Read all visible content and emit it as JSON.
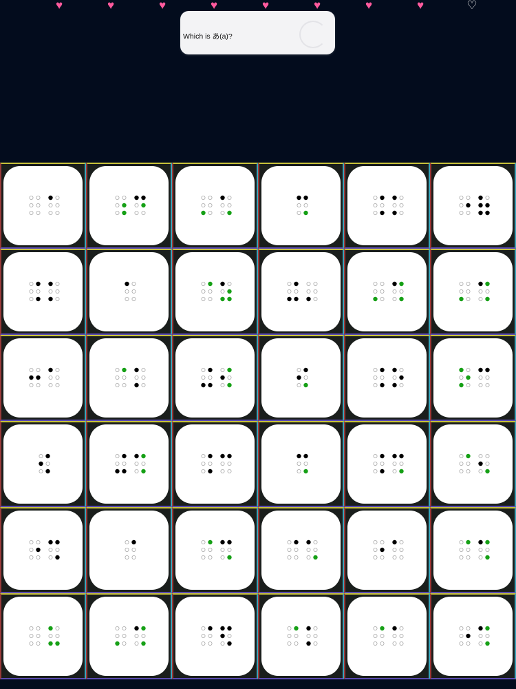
{
  "lives": {
    "total": 10,
    "remaining": 8
  },
  "question": {
    "prompt": "Which is あ(a)?"
  },
  "icons": {
    "heart_full": "heart-full-icon",
    "heart_empty": "heart-outline-icon",
    "spinner": "loading-spinner-icon"
  },
  "colors": {
    "background": "#030c1d",
    "heart": "#ff5a9d",
    "dot_raised": "#000000",
    "dot_highlight": "#16a016",
    "tile": "#ffffff"
  },
  "grid": {
    "rows": 6,
    "cols": 6,
    "cells": [
      [
        [
          0,
          0,
          0,
          0,
          0,
          0,
          1,
          0,
          0,
          0,
          0,
          0
        ]
      ],
      [
        [
          0,
          0,
          0,
          0,
          2,
          2,
          1,
          0,
          0,
          1,
          2,
          0
        ]
      ],
      [
        [
          0,
          0,
          2,
          0,
          0,
          0,
          1,
          0,
          0,
          0,
          0,
          2
        ]
      ],
      [
        [
          1,
          0,
          0,
          1,
          0,
          2
        ]
      ],
      [
        [
          0,
          0,
          0,
          1,
          0,
          1,
          1,
          0,
          1,
          0,
          0,
          0
        ]
      ],
      [
        [
          0,
          0,
          0,
          0,
          1,
          0,
          1,
          1,
          1,
          0,
          1,
          1
        ]
      ],
      [
        [
          0,
          0,
          0,
          1,
          0,
          1,
          1,
          0,
          1,
          0,
          0,
          0
        ]
      ],
      [
        [
          1,
          0,
          0,
          0,
          0,
          0
        ]
      ],
      [
        [
          0,
          0,
          0,
          2,
          0,
          0,
          1,
          0,
          2,
          0,
          2,
          2
        ]
      ],
      [
        [
          0,
          0,
          1,
          1,
          0,
          1,
          0,
          0,
          1,
          0,
          0,
          0
        ]
      ],
      [
        [
          0,
          0,
          2,
          0,
          0,
          0,
          1,
          0,
          0,
          2,
          0,
          2
        ]
      ],
      [
        [
          0,
          0,
          2,
          0,
          0,
          0,
          1,
          0,
          0,
          2,
          0,
          2
        ]
      ],
      [
        [
          0,
          1,
          0,
          0,
          1,
          0,
          1,
          0,
          0,
          0,
          0,
          0
        ]
      ],
      [
        [
          0,
          0,
          0,
          2,
          0,
          0,
          1,
          0,
          1,
          0,
          0,
          0
        ]
      ],
      [
        [
          0,
          0,
          1,
          1,
          0,
          1,
          0,
          1,
          0,
          2,
          0,
          2
        ]
      ],
      [
        [
          0,
          1,
          0,
          1,
          0,
          2
        ]
      ],
      [
        [
          0,
          0,
          0,
          1,
          0,
          1,
          1,
          0,
          1,
          0,
          1,
          0
        ]
      ],
      [
        [
          2,
          0,
          2,
          0,
          2,
          0,
          1,
          0,
          0,
          1,
          0,
          0
        ]
      ],
      [
        [
          0,
          1,
          0,
          1,
          0,
          1
        ]
      ],
      [
        [
          0,
          0,
          1,
          1,
          0,
          1,
          1,
          0,
          0,
          2,
          0,
          2
        ]
      ],
      [
        [
          0,
          0,
          0,
          1,
          0,
          1,
          1,
          0,
          0,
          1,
          0,
          0
        ]
      ],
      [
        [
          1,
          0,
          0,
          1,
          0,
          2
        ]
      ],
      [
        [
          0,
          0,
          0,
          1,
          0,
          1,
          1,
          0,
          0,
          1,
          0,
          2
        ]
      ],
      [
        [
          0,
          0,
          0,
          2,
          0,
          0,
          0,
          1,
          0,
          0,
          0,
          2
        ]
      ],
      [
        [
          0,
          0,
          0,
          0,
          1,
          0,
          1,
          0,
          0,
          1,
          0,
          1
        ]
      ],
      [
        [
          0,
          0,
          0,
          1,
          0,
          0
        ]
      ],
      [
        [
          0,
          0,
          0,
          2,
          0,
          0,
          1,
          0,
          0,
          1,
          0,
          2
        ]
      ],
      [
        [
          0,
          0,
          0,
          1,
          0,
          0,
          1,
          0,
          0,
          0,
          0,
          2
        ]
      ],
      [
        [
          0,
          0,
          0,
          0,
          1,
          0,
          1,
          0,
          0,
          0,
          0,
          0
        ]
      ],
      [
        [
          0,
          0,
          0,
          2,
          0,
          0,
          1,
          0,
          0,
          2,
          0,
          2
        ]
      ],
      [
        [
          0,
          0,
          0,
          0,
          0,
          0,
          2,
          0,
          2,
          0,
          0,
          2
        ]
      ],
      [
        [
          0,
          0,
          2,
          0,
          0,
          0,
          1,
          0,
          0,
          2,
          0,
          2
        ]
      ],
      [
        [
          0,
          0,
          0,
          1,
          0,
          0,
          1,
          1,
          0,
          1,
          0,
          1
        ]
      ],
      [
        [
          0,
          0,
          0,
          2,
          0,
          0,
          1,
          0,
          1,
          0,
          0,
          0
        ]
      ],
      [
        [
          0,
          0,
          0,
          2,
          0,
          0,
          1,
          0,
          0,
          0,
          0,
          0
        ]
      ],
      [
        [
          0,
          0,
          0,
          0,
          1,
          0,
          1,
          0,
          0,
          2,
          0,
          2
        ]
      ]
    ]
  }
}
